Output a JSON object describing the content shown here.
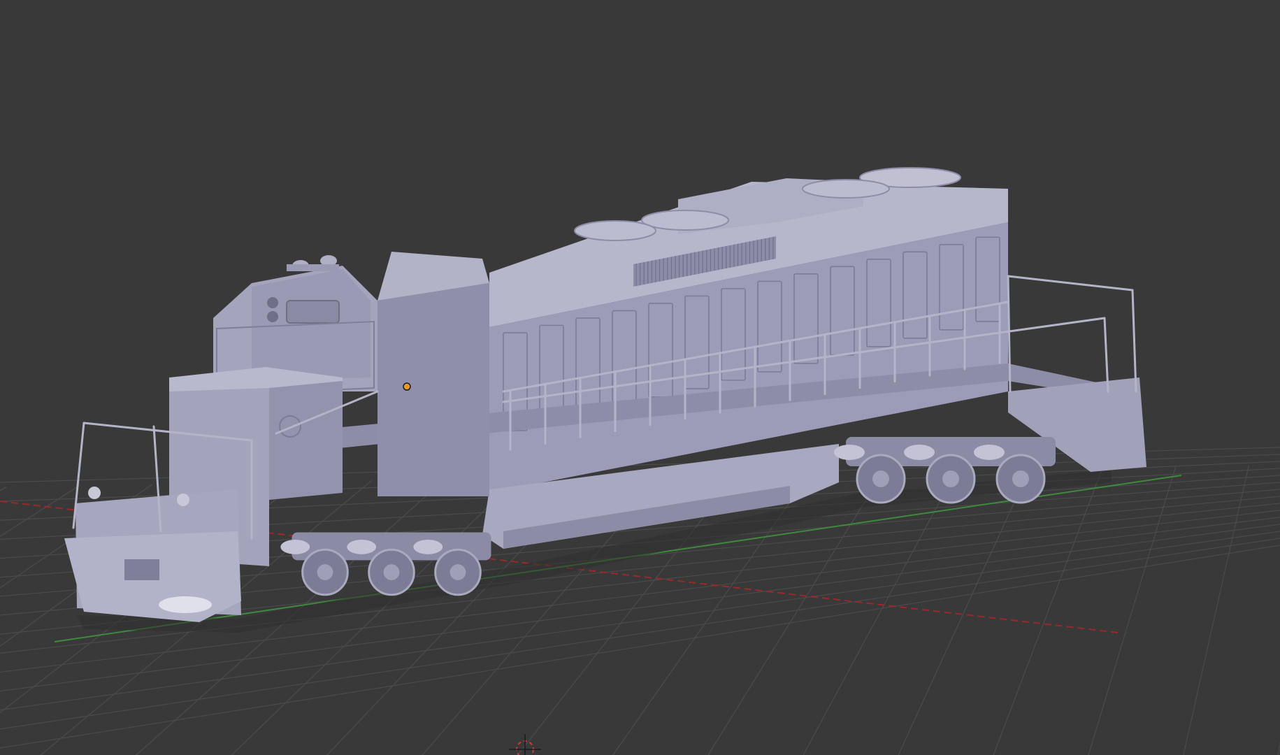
{
  "viewport": {
    "background": "#393939",
    "grid_color": "#4b4b4b",
    "x_axis_color": "#9a2a2a",
    "y_axis_color": "#3d8a3d"
  },
  "model": {
    "body_color": "#9c9cb8",
    "body_shade": "#8a8aa6",
    "body_light": "#b7b7cc",
    "body_dark": "#6f6f88",
    "origin_color": "#e59a2c",
    "cursor_color": "#d23a3a"
  }
}
